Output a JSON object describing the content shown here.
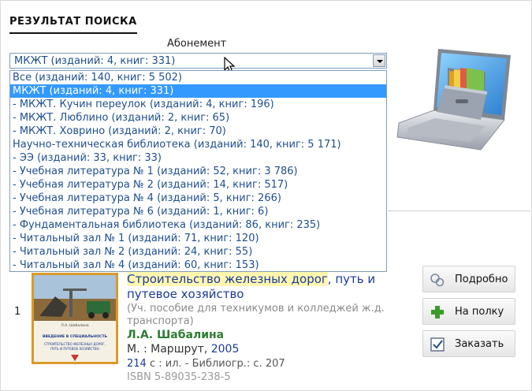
{
  "page": {
    "title": "РЕЗУЛЬТАТ ПОИСКА"
  },
  "subscription": {
    "label": "Абонемент",
    "selected": "МКЖТ (изданий: 4, книг: 331)",
    "options": [
      "Все (изданий: 140, книг: 5 502)",
      "МКЖТ (изданий: 4, книг: 331)",
      "- МКЖТ. Кучин переулок (изданий: 4, книг: 196)",
      "- МКЖТ. Люблино (изданий: 2, книг: 65)",
      "- МКЖТ. Ховрино (изданий: 2, книг: 70)",
      "Научно-техническая библиотека (изданий: 140, книг: 5 171)",
      "- ЭЭ (изданий: 33, книг: 33)",
      "- Учебная литература № 1 (изданий: 52, книг: 3 786)",
      "- Учебная литература № 2 (изданий: 14, книг: 517)",
      "- Учебная литература № 4 (изданий: 5, книг: 266)",
      "- Учебная литература № 6 (изданий: 1, книг: 6)",
      "- Фундаментальная библиотека (изданий: 86, книг: 235)",
      "- Читальный зал № 1 (изданий: 71, книг: 120)",
      "- Читальный зал № 2 (изданий: 24, книг: 55)",
      "- Читальный зал № 4 (изданий: 60, книг: 153)"
    ],
    "selected_index": 1
  },
  "result": {
    "number": "1",
    "title_highlight": "Строительство железных дорог",
    "title_rest": ", путь и путевое хозяйство",
    "subtitle": "(Уч. пособие для техникумов и колледжей ж.д. транспорта)",
    "author": "Л.А. Шабалина",
    "publisher": "М. : Маршрут, ",
    "year": "2005",
    "pages_num": "214",
    "pages_rest": " с : ил. - Библиогр.: с. 207",
    "isbn": "ISBN 5-89035-238-5",
    "cover_text": {
      "author": "Л.А. Шабалина",
      "series_line1": "ВВЕДЕНИЕ В СПЕЦИАЛЬНОСТЬ",
      "series_line2": "СТРОИТЕЛЬСТВО ЖЕЛЕЗНЫХ ДОРОГ,",
      "series_line3": "ПУТЬ И ПУТЕВОЕ ХОЗЯЙСТВО"
    }
  },
  "actions": {
    "details": "Подробно",
    "to_shelf": "На полку",
    "order": "Заказать"
  },
  "icons": {
    "details": "details-icon",
    "to_shelf": "plus-icon",
    "order": "checkbox-icon"
  },
  "colors": {
    "link": "#1a3a9a",
    "selected_bg": "#3399ff",
    "author": "#2e7d32",
    "highlight": "#fff7b0"
  }
}
